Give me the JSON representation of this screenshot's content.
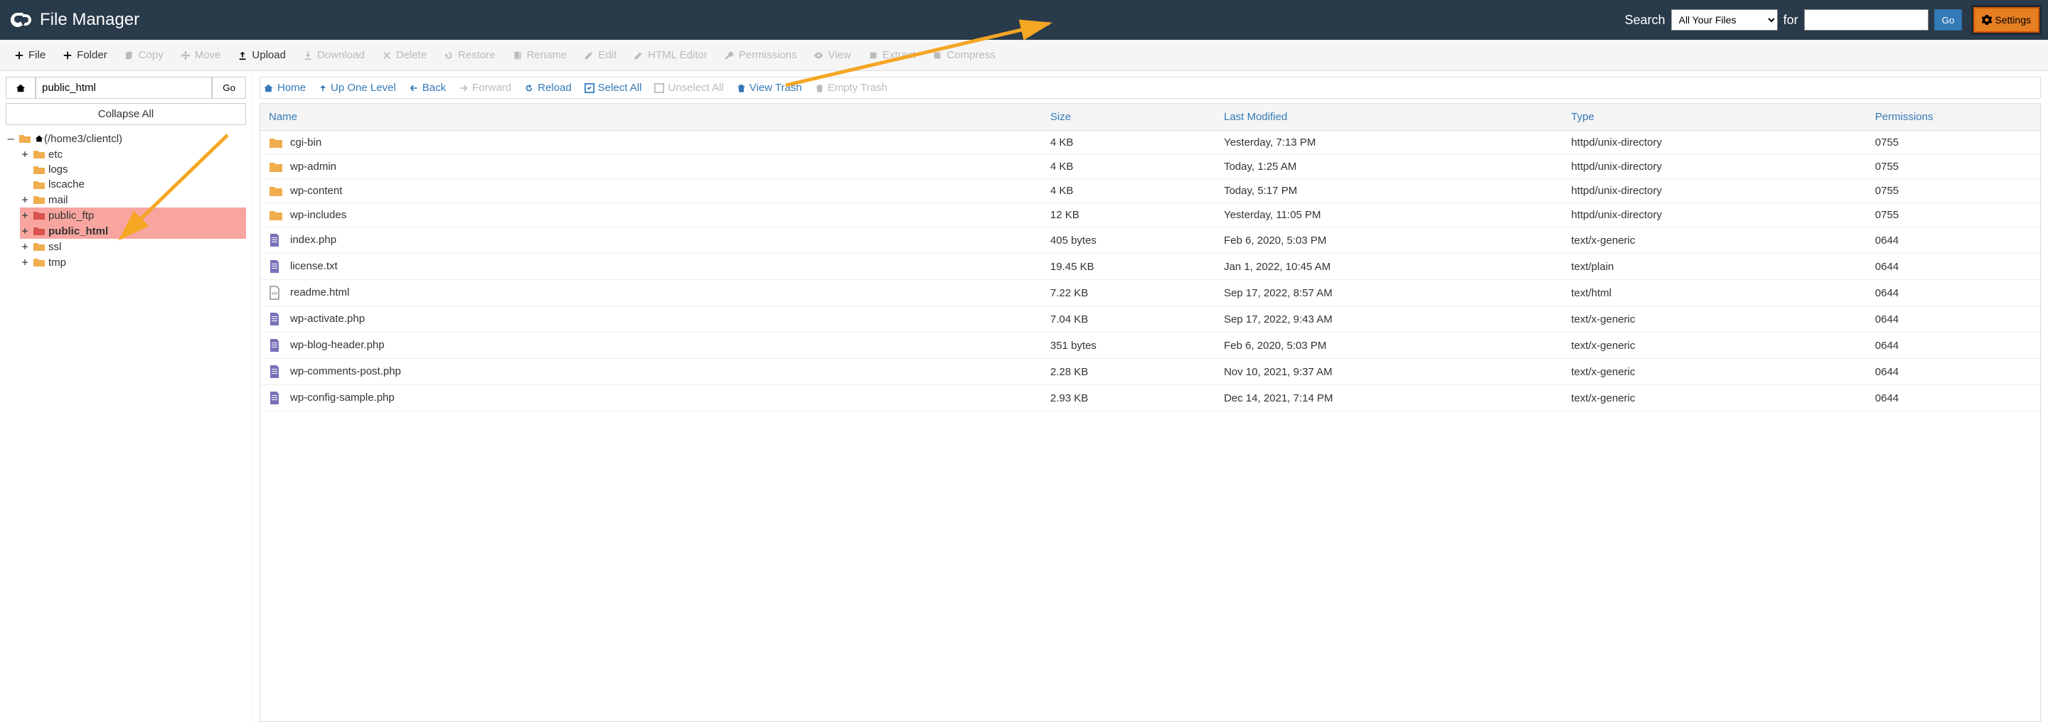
{
  "header": {
    "title": "File Manager",
    "search_label": "Search",
    "search_select": "All Your Files",
    "for_label": "for",
    "go_label": "Go",
    "settings_label": "Settings"
  },
  "toolbar": {
    "file": "File",
    "folder": "Folder",
    "copy": "Copy",
    "move": "Move",
    "upload": "Upload",
    "download": "Download",
    "delete": "Delete",
    "restore": "Restore",
    "rename": "Rename",
    "edit": "Edit",
    "html_editor": "HTML Editor",
    "permissions": "Permissions",
    "view": "View",
    "extract": "Extract",
    "compress": "Compress"
  },
  "sidebar": {
    "path_value": "public_html",
    "go_label": "Go",
    "collapse_all": "Collapse All",
    "root_label": "(/home3/clientcl)",
    "nodes": {
      "etc": "etc",
      "logs": "logs",
      "lscache": "lscache",
      "mail": "mail",
      "public_ftp": "public_ftp",
      "public_html": "public_html",
      "ssl": "ssl",
      "tmp": "tmp"
    }
  },
  "nav": {
    "home": "Home",
    "up_one": "Up One Level",
    "back": "Back",
    "forward": "Forward",
    "reload": "Reload",
    "select_all": "Select All",
    "unselect_all": "Unselect All",
    "view_trash": "View Trash",
    "empty_trash": "Empty Trash"
  },
  "table": {
    "headers": {
      "name": "Name",
      "size": "Size",
      "modified": "Last Modified",
      "type": "Type",
      "permissions": "Permissions"
    },
    "rows": [
      {
        "icon": "folder",
        "name": "cgi-bin",
        "size": "4 KB",
        "modified": "Yesterday, 7:13 PM",
        "type": "httpd/unix-directory",
        "permissions": "0755"
      },
      {
        "icon": "folder",
        "name": "wp-admin",
        "size": "4 KB",
        "modified": "Today, 1:25 AM",
        "type": "httpd/unix-directory",
        "permissions": "0755"
      },
      {
        "icon": "folder",
        "name": "wp-content",
        "size": "4 KB",
        "modified": "Today, 5:17 PM",
        "type": "httpd/unix-directory",
        "permissions": "0755"
      },
      {
        "icon": "folder",
        "name": "wp-includes",
        "size": "12 KB",
        "modified": "Yesterday, 11:05 PM",
        "type": "httpd/unix-directory",
        "permissions": "0755"
      },
      {
        "icon": "file",
        "name": "index.php",
        "size": "405 bytes",
        "modified": "Feb 6, 2020, 5:03 PM",
        "type": "text/x-generic",
        "permissions": "0644"
      },
      {
        "icon": "file",
        "name": "license.txt",
        "size": "19.45 KB",
        "modified": "Jan 1, 2022, 10:45 AM",
        "type": "text/plain",
        "permissions": "0644"
      },
      {
        "icon": "html",
        "name": "readme.html",
        "size": "7.22 KB",
        "modified": "Sep 17, 2022, 8:57 AM",
        "type": "text/html",
        "permissions": "0644"
      },
      {
        "icon": "file",
        "name": "wp-activate.php",
        "size": "7.04 KB",
        "modified": "Sep 17, 2022, 9:43 AM",
        "type": "text/x-generic",
        "permissions": "0644"
      },
      {
        "icon": "file",
        "name": "wp-blog-header.php",
        "size": "351 bytes",
        "modified": "Feb 6, 2020, 5:03 PM",
        "type": "text/x-generic",
        "permissions": "0644"
      },
      {
        "icon": "file",
        "name": "wp-comments-post.php",
        "size": "2.28 KB",
        "modified": "Nov 10, 2021, 9:37 AM",
        "type": "text/x-generic",
        "permissions": "0644"
      },
      {
        "icon": "file",
        "name": "wp-config-sample.php",
        "size": "2.93 KB",
        "modified": "Dec 14, 2021, 7:14 PM",
        "type": "text/x-generic",
        "permissions": "0644"
      }
    ]
  }
}
